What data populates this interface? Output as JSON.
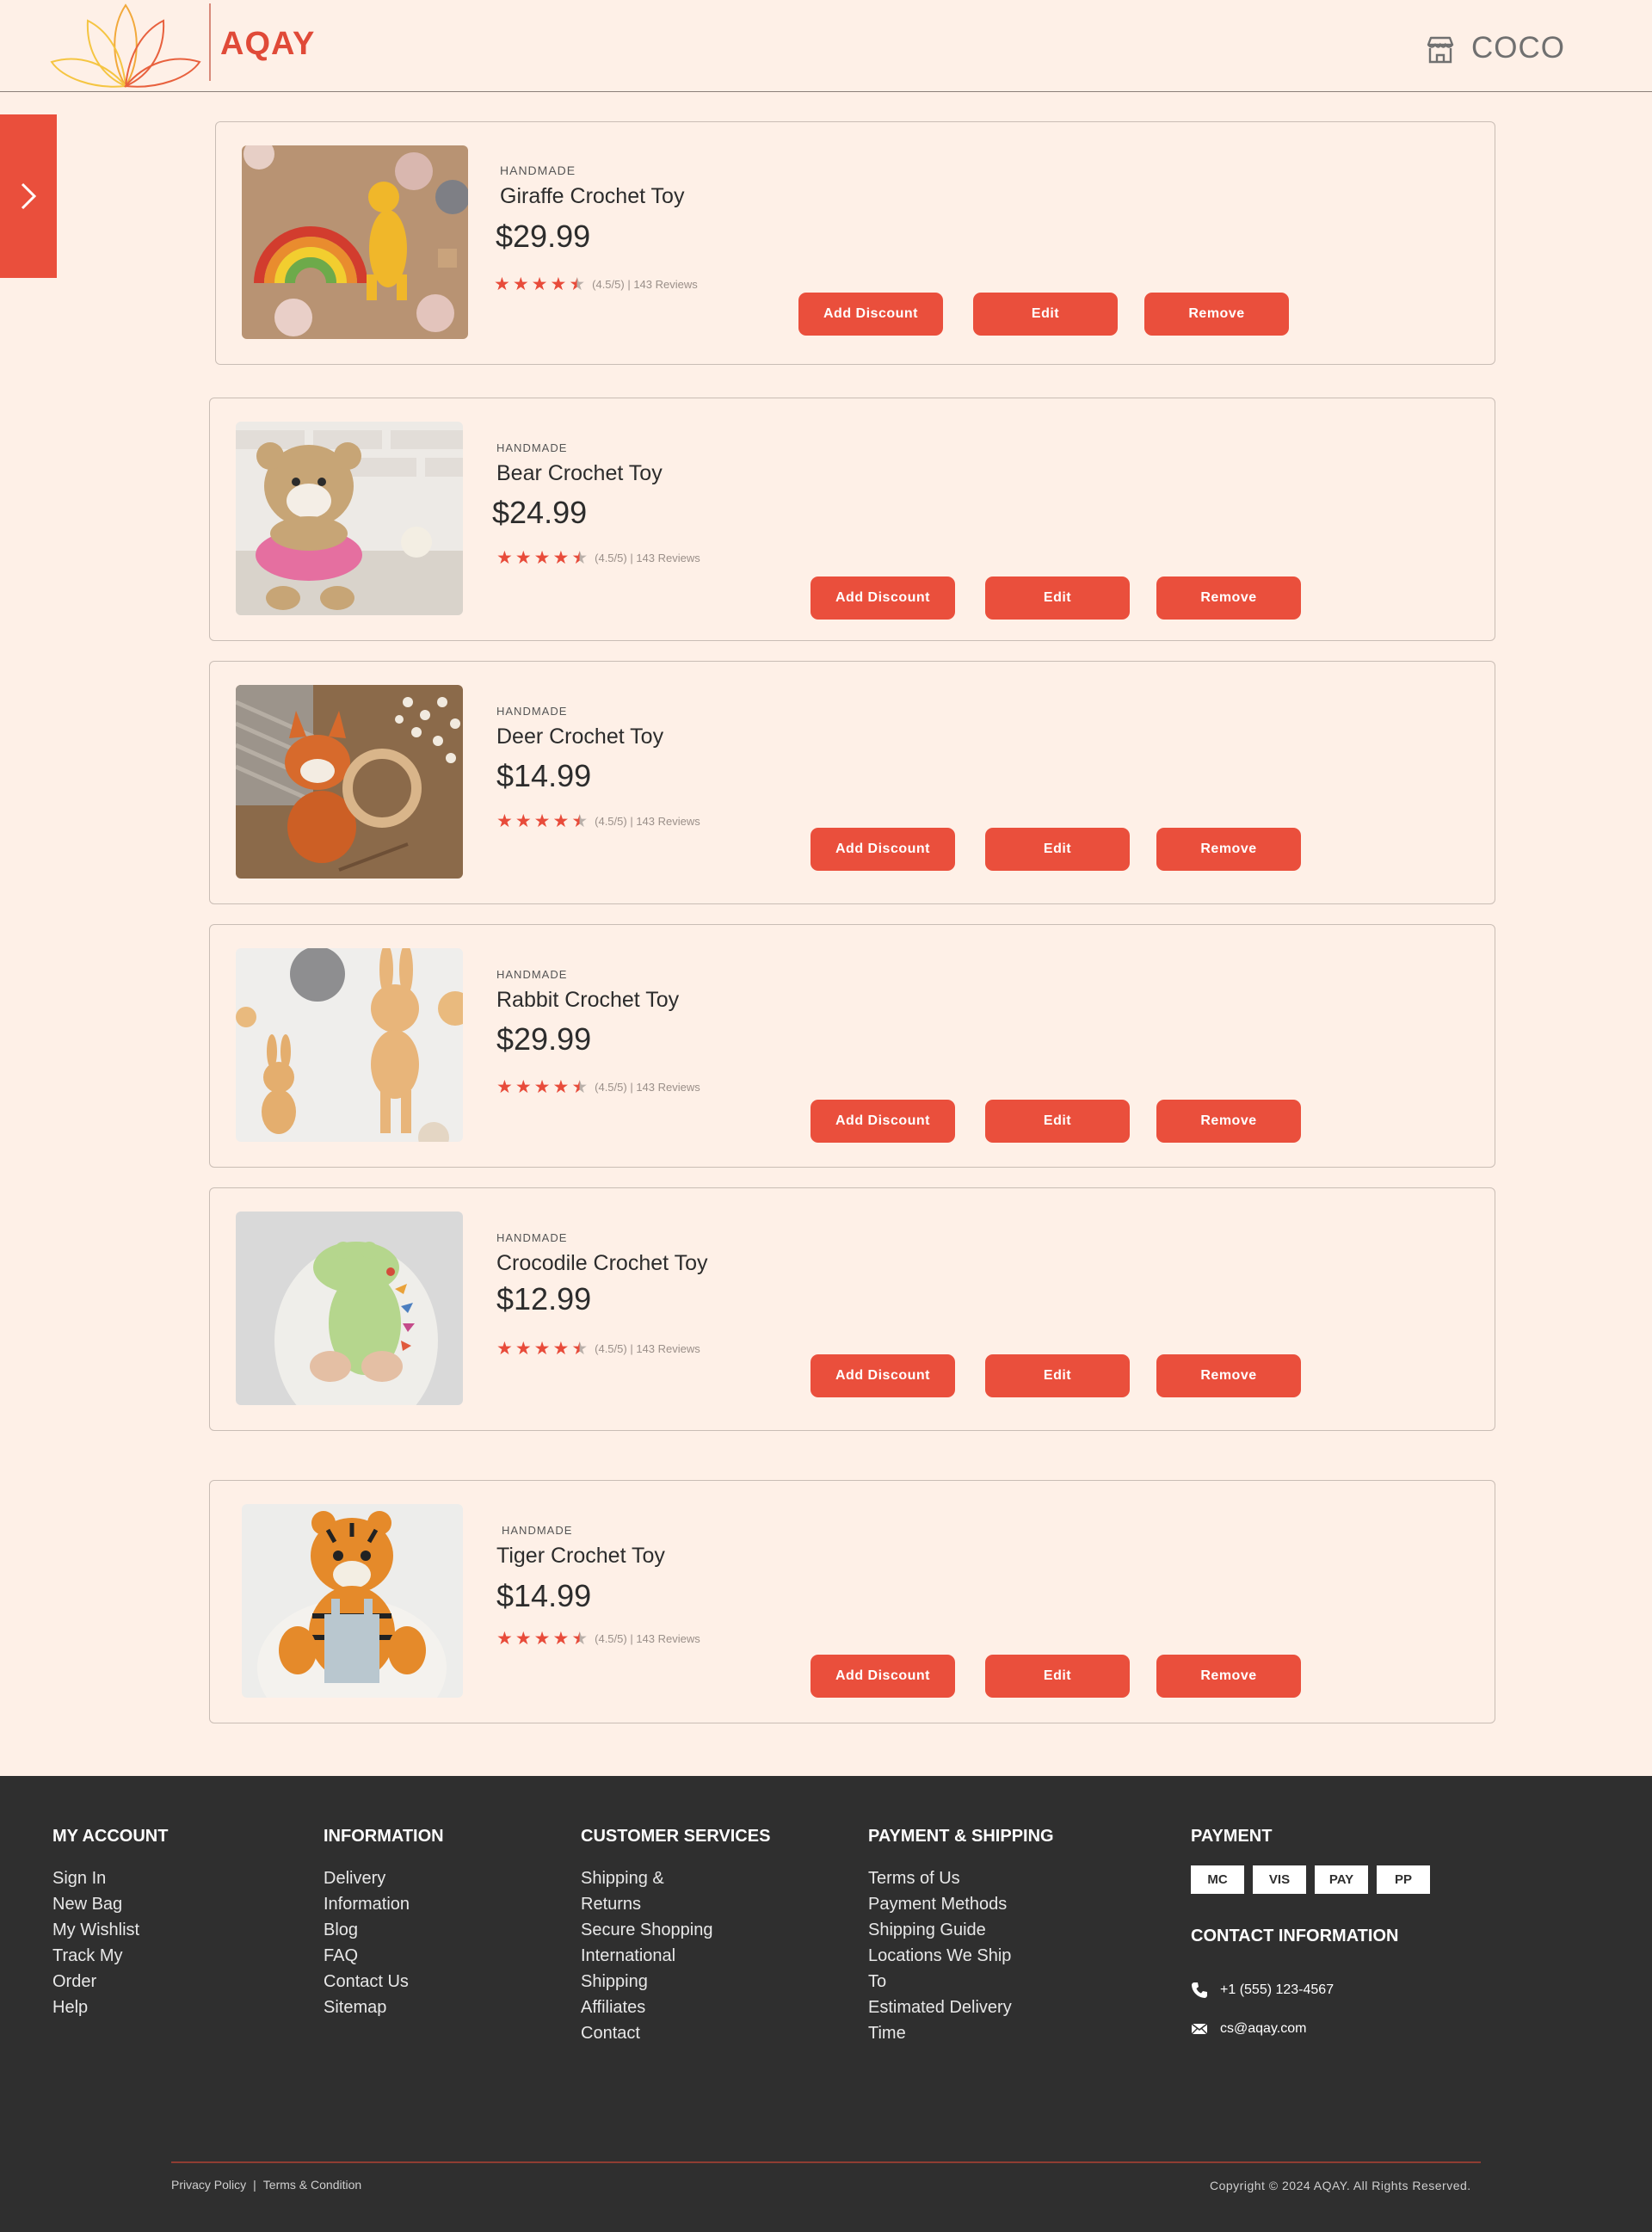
{
  "brand": {
    "name": "AQAY"
  },
  "store": {
    "name": "COCO",
    "icon": "store-icon"
  },
  "side_toggle": {
    "icon": "chevron-right-icon"
  },
  "colors": {
    "accent": "#EA4F3C",
    "background": "#FEF0E7",
    "footer": "#2F2F2F"
  },
  "products": [
    {
      "tag": "HANDMADE",
      "title": "Giraffe Crochet Toy",
      "price": "$29.99",
      "rating": 4.5,
      "rating_text": "(4.5/5) | 143 Reviews",
      "btn_discount": "Add Discount",
      "btn_edit": "Edit",
      "btn_remove": "Remove"
    },
    {
      "tag": "HANDMADE",
      "title": "Bear Crochet Toy",
      "price": "$24.99",
      "rating": 4.5,
      "rating_text": "(4.5/5) | 143 Reviews",
      "btn_discount": "Add Discount",
      "btn_edit": "Edit",
      "btn_remove": "Remove"
    },
    {
      "tag": "HANDMADE",
      "title": "Deer Crochet Toy",
      "price": "$14.99",
      "rating": 4.5,
      "rating_text": "(4.5/5) | 143 Reviews",
      "btn_discount": "Add Discount",
      "btn_edit": "Edit",
      "btn_remove": "Remove"
    },
    {
      "tag": "HANDMADE",
      "title": "Rabbit Crochet Toy",
      "price": "$29.99",
      "rating": 4.5,
      "rating_text": "(4.5/5) | 143 Reviews",
      "btn_discount": "Add Discount",
      "btn_edit": "Edit",
      "btn_remove": "Remove"
    },
    {
      "tag": "HANDMADE",
      "title": "Crocodile Crochet Toy",
      "price": "$12.99",
      "rating": 4.5,
      "rating_text": "(4.5/5) | 143 Reviews",
      "btn_discount": "Add Discount",
      "btn_edit": "Edit",
      "btn_remove": "Remove"
    },
    {
      "tag": "HANDMADE",
      "title": "Tiger Crochet Toy",
      "price": "$14.99",
      "rating": 4.5,
      "rating_text": "(4.5/5) | 143 Reviews",
      "btn_discount": "Add Discount",
      "btn_edit": "Edit",
      "btn_remove": "Remove"
    }
  ],
  "footer": {
    "my_account": {
      "heading": "MY ACCOUNT",
      "links": [
        "Sign In",
        "New Bag",
        "My Wishlist",
        "Track My",
        "Order",
        "Help"
      ]
    },
    "information": {
      "heading": "INFORMATION",
      "links": [
        "Delivery",
        "Information",
        "Blog",
        "FAQ",
        "Contact Us",
        "Sitemap"
      ]
    },
    "customer_services": {
      "heading": "CUSTOMER SERVICES",
      "links": [
        "Shipping &",
        "Returns",
        "Secure Shopping",
        "International",
        "Shipping",
        "Affiliates",
        "Contact"
      ]
    },
    "payment_shipping": {
      "heading": "PAYMENT & SHIPPING",
      "links": [
        "Terms of Us",
        "Payment Methods",
        "Shipping Guide",
        "Locations We Ship",
        "To",
        "Estimated Delivery",
        "Time"
      ]
    },
    "payment": {
      "heading": "PAYMENT",
      "badges": [
        "MC",
        "VIS",
        "PAY",
        "PP"
      ]
    },
    "contact": {
      "heading": "CONTACT INFORMATION",
      "phone": "+1 (555) 123-4567",
      "email": "cs@aqay.com",
      "phone_icon": "phone-icon",
      "email_icon": "mail-icon"
    },
    "privacy": "Privacy Policy",
    "separator": "|",
    "terms": "Terms & Condition",
    "copyright": "Copyright © 2024 AQAY. All Rights Reserved."
  }
}
